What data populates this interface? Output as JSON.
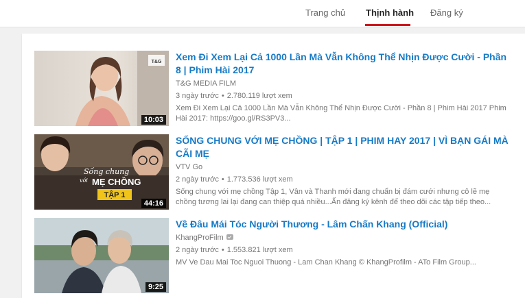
{
  "tabs": [
    {
      "label": "Trang chủ"
    },
    {
      "label": "Thịnh hành"
    },
    {
      "label": "Đăng ký"
    }
  ],
  "videos": [
    {
      "title": "Xem Đi Xem Lại Cả 1000 Lần Mà Vẫn Không Thể Nhịn Được Cười - Phần 8 | Phim Hài 2017",
      "channel": "T&G MEDIA FILM",
      "age": "3 ngày trước",
      "views": "2.780.119 lượt xem",
      "description": "Xem Đi Xem Lại Cả 1000 Lần Mà Vẫn Không Thể Nhịn Được Cười - Phần 8 | Phim Hài 2017 Phim Hài 2017: https://goo.gl/RS3PV3...",
      "duration": "10:03",
      "thumb_logo": "T&G"
    },
    {
      "title": "SỐNG CHUNG VỚI MẸ CHỒNG | TẬP 1 | PHIM HAY 2017 | VÌ BẠN GÁI MÀ CÃI MẸ",
      "channel": "VTV Go",
      "age": "2 ngày trước",
      "views": "1.773.536 lượt xem",
      "description": "Sống chung với mẹ chồng Tập 1, Vân và Thanh mới đang chuẩn bị đám cưới nhưng cô lẽ mẹ chồng tương lai lại đang can thiệp quá nhiều...Ấn đăng ký kênh để theo dõi các tập tiếp theo...",
      "duration": "44:16",
      "thumb_text_1": "Sống chung",
      "thumb_text_2": "với",
      "thumb_text_3": "MẸ CHỒNG",
      "thumb_badge": "TẬP 1"
    },
    {
      "title": "Về Đâu Mái Tóc Người Thương - Lâm Chấn Khang (Official)",
      "channel": "KhangProFilm",
      "age": "2 ngày trước",
      "views": "1.553.821 lượt xem",
      "description": "MV Ve Dau Mai Toc Nguoi Thuong - Lam Chan Khang © KhangProfilm - ATo Film Group...",
      "duration": "9:25"
    }
  ]
}
